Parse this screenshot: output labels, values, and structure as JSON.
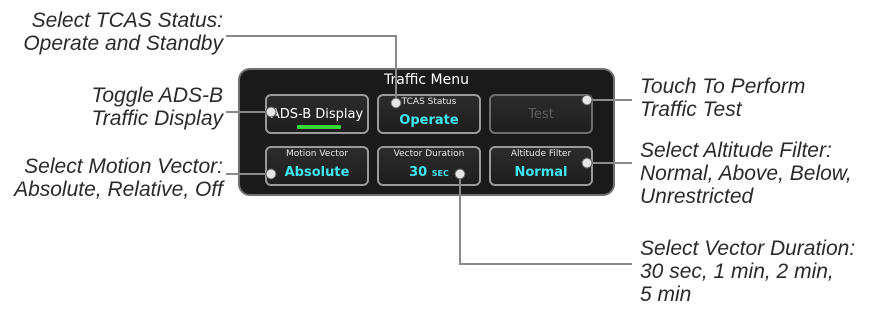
{
  "panel": {
    "title": "Traffic Menu",
    "buttons": {
      "adsb_display": {
        "label": "ADS-B Display",
        "indicator": "on",
        "indicator_color": "#36d63b"
      },
      "tcas_status": {
        "caption": "TCAS Status",
        "value": "Operate"
      },
      "test": {
        "label": "Test",
        "state": "disabled"
      },
      "motion_vector": {
        "caption": "Motion Vector",
        "value": "Absolute"
      },
      "vector_duration": {
        "caption": "Vector Duration",
        "value": "30",
        "unit": "SEC"
      },
      "altitude_filter": {
        "caption": "Altitude Filter",
        "value": "Normal"
      }
    }
  },
  "callouts": {
    "tcas_status": [
      "Select TCAS Status:",
      "Operate and Standby"
    ],
    "adsb_toggle": [
      "Toggle ADS-B",
      "Traffic Display"
    ],
    "motion_vector": [
      "Select Motion Vector:",
      "Absolute, Relative, Off"
    ],
    "traffic_test": [
      "Touch To Perform",
      "Traffic Test"
    ],
    "altitude_filter": [
      "Select Altitude Filter:",
      "Normal, Above, Below,",
      "Unrestricted"
    ],
    "vector_duration": [
      "Select Vector Duration:",
      "30 sec, 1 min, 2 min,",
      "5 min"
    ]
  },
  "colors": {
    "value_text": "#3ee6f0",
    "panel_bg": "#1a1a1a",
    "leader": "#8a8a8a"
  }
}
